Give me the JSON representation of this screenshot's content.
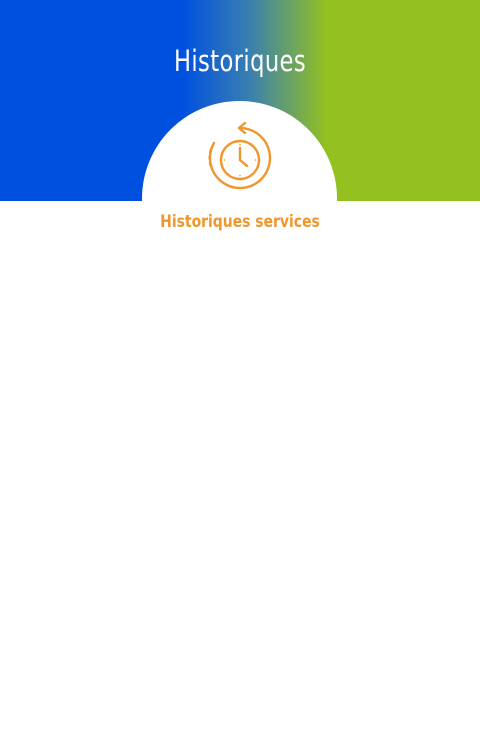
{
  "header": {
    "title": "Historiques"
  },
  "services": [
    {
      "label": "Historiques services",
      "icon": "history-clock-icon"
    }
  ],
  "colors": {
    "gradient_left": "#0050e0",
    "gradient_right": "#94c020",
    "accent": "#f0962a",
    "background": "#ffffff"
  }
}
